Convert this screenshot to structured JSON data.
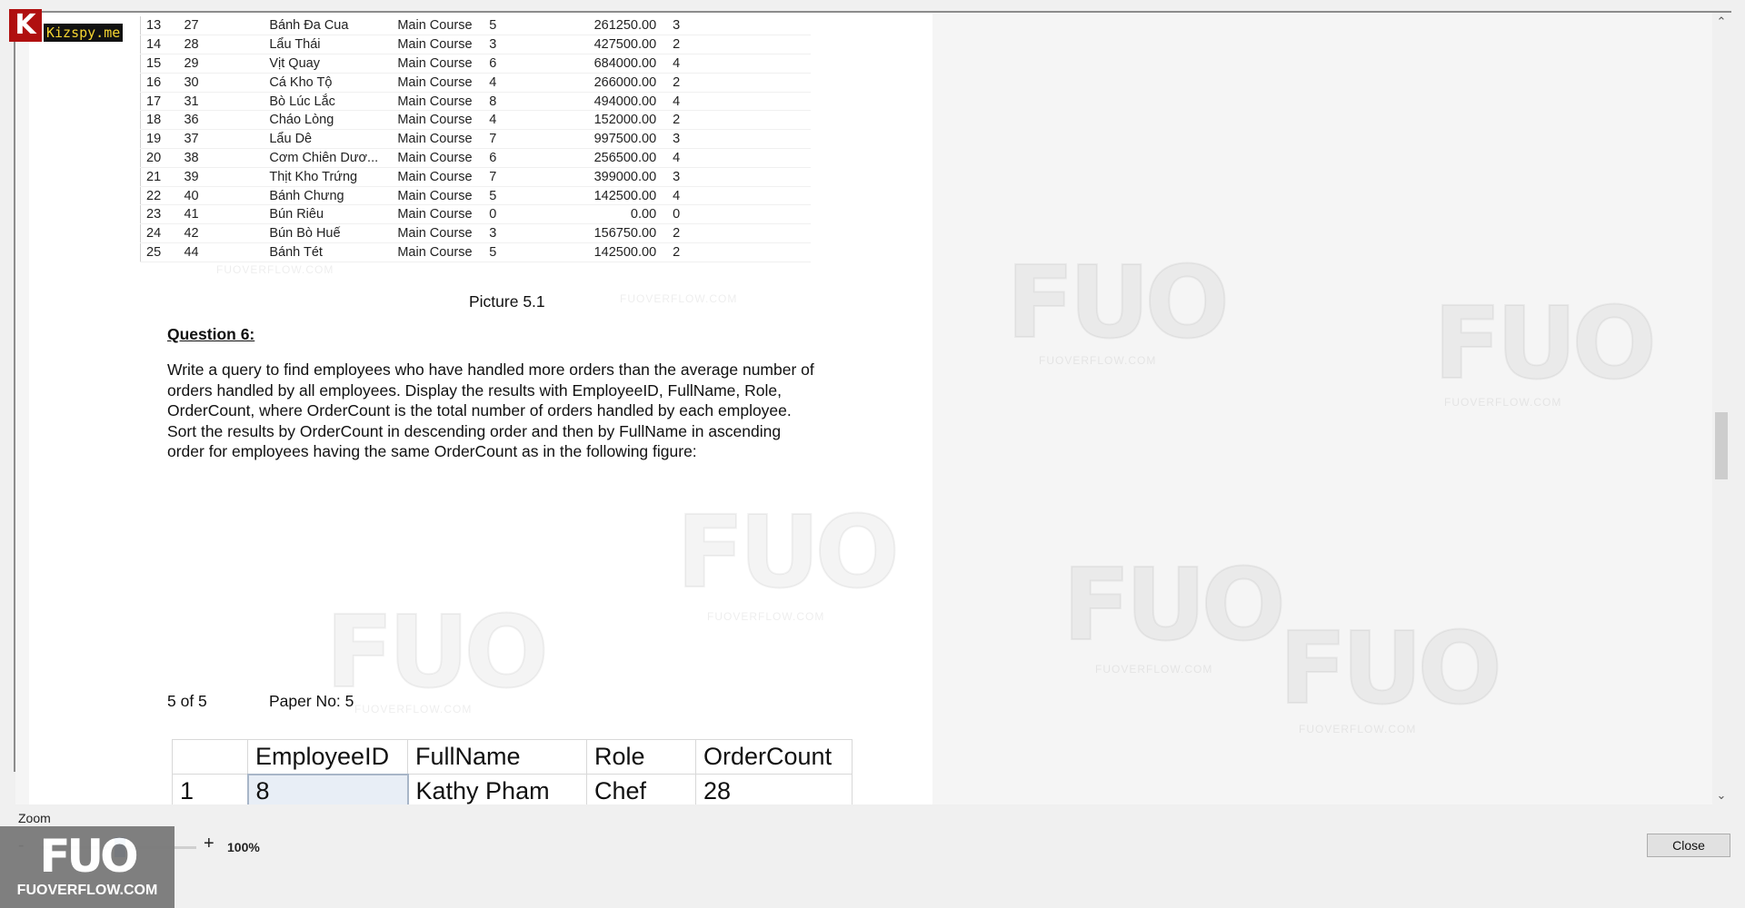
{
  "logo": {
    "letter": "K",
    "text": "Kizspy.me"
  },
  "document": {
    "result_rows": [
      [
        "13",
        "27",
        "Bánh Đa Cua",
        "Main Course",
        "5",
        "261250.00",
        "3"
      ],
      [
        "14",
        "28",
        "Lẩu Thái",
        "Main Course",
        "3",
        "427500.00",
        "2"
      ],
      [
        "15",
        "29",
        "Vịt Quay",
        "Main Course",
        "6",
        "684000.00",
        "4"
      ],
      [
        "16",
        "30",
        "Cá Kho Tộ",
        "Main Course",
        "4",
        "266000.00",
        "2"
      ],
      [
        "17",
        "31",
        "Bò Lúc Lắc",
        "Main Course",
        "8",
        "494000.00",
        "4"
      ],
      [
        "18",
        "36",
        "Cháo Lòng",
        "Main Course",
        "4",
        "152000.00",
        "2"
      ],
      [
        "19",
        "37",
        "Lẩu Dê",
        "Main Course",
        "7",
        "997500.00",
        "3"
      ],
      [
        "20",
        "38",
        "Cơm Chiên Dươ...",
        "Main Course",
        "6",
        "256500.00",
        "4"
      ],
      [
        "21",
        "39",
        "Thịt Kho Trứng",
        "Main Course",
        "7",
        "399000.00",
        "3"
      ],
      [
        "22",
        "40",
        "Bánh Chưng",
        "Main Course",
        "5",
        "142500.00",
        "4"
      ],
      [
        "23",
        "41",
        "Bún Riêu",
        "Main Course",
        "0",
        "0.00",
        "0"
      ],
      [
        "24",
        "42",
        "Bún Bò Huế",
        "Main Course",
        "3",
        "156750.00",
        "2"
      ],
      [
        "25",
        "44",
        "Bánh Tét",
        "Main Course",
        "5",
        "142500.00",
        "2"
      ]
    ],
    "caption": "Picture 5.1",
    "question_title": "Question 6:",
    "question_lines": [
      "Write a query to find employees who have handled more orders than the average number of",
      "orders handled by all employees. Display the results with EmployeeID, FullName, Role,",
      "OrderCount, where OrderCount is the total number of orders handled by each employee.",
      "Sort the results by OrderCount in descending order and then by FullName in ascending",
      "order for employees having the same OrderCount as in the following figure:"
    ],
    "page_number": "5 of 5",
    "paper_number": "Paper No: 5",
    "employee_table": {
      "headers": [
        "",
        "EmployeeID",
        "FullName",
        "Role",
        "OrderCount"
      ],
      "rows": [
        [
          "1",
          "8",
          "Kathy Pham",
          "Chef",
          "28"
        ]
      ]
    }
  },
  "watermark": {
    "brand": "FUO",
    "site": "FUOVERFLOW.COM"
  },
  "zoom": {
    "label": "Zoom",
    "minus": "-",
    "plus": "+",
    "value": "100%"
  },
  "badge": {
    "brand": "FUO",
    "site": "FUOVERFLOW.COM"
  },
  "close_label": "Close",
  "scroll": {
    "up": "⌃",
    "down": "⌄"
  }
}
